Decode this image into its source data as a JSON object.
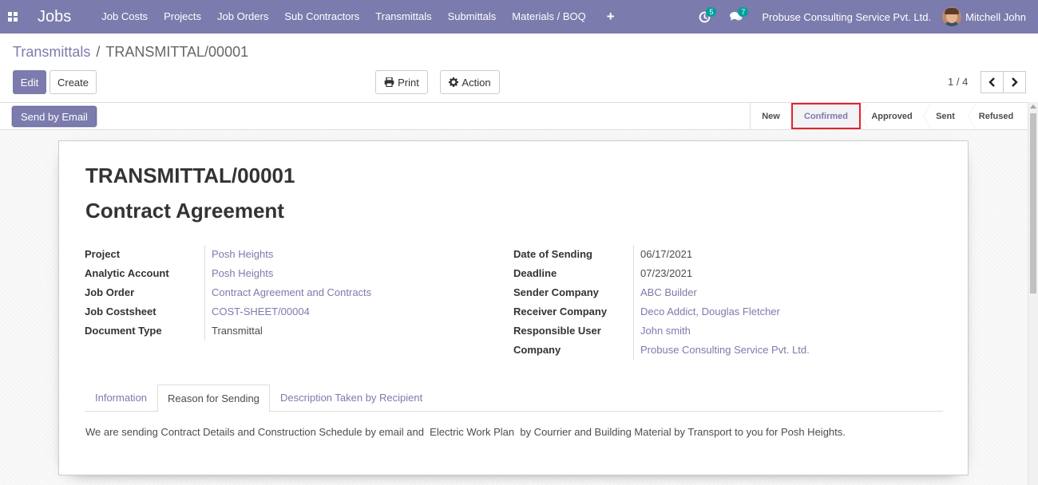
{
  "nav": {
    "app_title": "Jobs",
    "menu": [
      "Job Costs",
      "Projects",
      "Job Orders",
      "Sub Contractors",
      "Transmittals",
      "Submittals",
      "Materials / BOQ"
    ],
    "plus": "+",
    "activity_count": "5",
    "message_count": "7",
    "company": "Probuse Consulting Service Pvt. Ltd.",
    "user": "Mitchell John",
    "accent": "#7c7bad"
  },
  "breadcrumb": {
    "parent": "Transmittals",
    "separator": "/",
    "current": "TRANSMITTAL/00001"
  },
  "buttons": {
    "edit": "Edit",
    "create": "Create",
    "print": "Print",
    "action": "Action",
    "send_email": "Send by Email"
  },
  "pager": {
    "value": "1 / 4"
  },
  "stages": [
    {
      "label": "New",
      "current": false
    },
    {
      "label": "Confirmed",
      "current": true
    },
    {
      "label": "Approved",
      "current": false
    },
    {
      "label": "Sent",
      "current": false
    },
    {
      "label": "Refused",
      "current": false
    }
  ],
  "record": {
    "reference": "TRANSMITTAL/00001",
    "name": "Contract Agreement",
    "left_fields": [
      {
        "label": "Project",
        "value": "Posh Heights",
        "link": true
      },
      {
        "label": "Analytic Account",
        "value": "Posh Heights",
        "link": true
      },
      {
        "label": "Job Order",
        "value": "Contract Agreement and Contracts",
        "link": true
      },
      {
        "label": "Job Costsheet",
        "value": "COST-SHEET/00004",
        "link": true
      },
      {
        "label": "Document Type",
        "value": "Transmittal",
        "link": false
      }
    ],
    "right_fields": [
      {
        "label": "Date of Sending",
        "value": "06/17/2021",
        "link": false
      },
      {
        "label": "Deadline",
        "value": "07/23/2021",
        "link": false
      },
      {
        "label": "Sender Company",
        "value": "ABC Builder",
        "link": true
      },
      {
        "label": "Receiver Company",
        "value": "Deco Addict, Douglas Fletcher",
        "link": true
      },
      {
        "label": "Responsible User",
        "value": "John smith",
        "link": true
      },
      {
        "label": "Company",
        "value": "Probuse Consulting Service Pvt. Ltd.",
        "link": true
      }
    ]
  },
  "tabs": [
    {
      "label": "Information",
      "active": false
    },
    {
      "label": "Reason for Sending",
      "active": true
    },
    {
      "label": "Description Taken by Recipient",
      "active": false
    }
  ],
  "reason_text": "We are sending Contract Details and Construction Schedule by email and  Electric Work Plan  by Courrier and Building Material by Transport to you for Posh Heights."
}
